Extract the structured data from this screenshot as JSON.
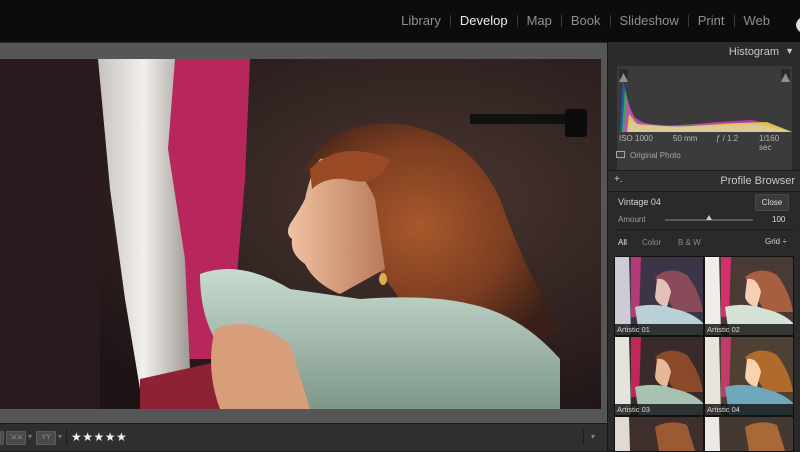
{
  "modules": [
    {
      "label": "Library",
      "active": false
    },
    {
      "label": "Develop",
      "active": true
    },
    {
      "label": "Map",
      "active": false
    },
    {
      "label": "Book",
      "active": false
    },
    {
      "label": "Slideshow",
      "active": false
    },
    {
      "label": "Print",
      "active": false
    },
    {
      "label": "Web",
      "active": false
    }
  ],
  "toolbar": {
    "stars": "★★★★★",
    "btn1": "⇲⇲",
    "btn2": "YY"
  },
  "histogram": {
    "title": "Histogram",
    "iso": "ISO 1000",
    "focal": "50 mm",
    "aperture": "ƒ / 1.2",
    "shutter": "1/160 sec",
    "original_photo": "Original Photo"
  },
  "profile_browser": {
    "title": "Profile Browser",
    "profile_name": "Vintage 04",
    "close_label": "Close",
    "amount_label": "Amount",
    "amount_value": "100",
    "amount_fraction": 0.5,
    "filters": [
      "All",
      "Color",
      "B & W"
    ],
    "view_label": "Grid ÷",
    "thumbnails": [
      {
        "label": "Artistic 01"
      },
      {
        "label": "Artistic 02"
      },
      {
        "label": "Artistic 03"
      },
      {
        "label": "Artistic 04"
      }
    ]
  }
}
